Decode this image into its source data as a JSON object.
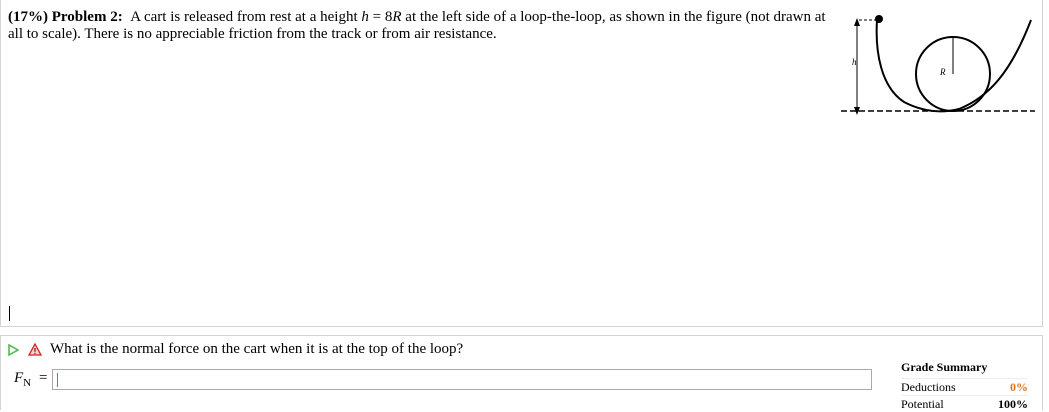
{
  "problem": {
    "percent": "(17%)",
    "label": "Problem 2:",
    "text_1": "A cart is released from rest at a height",
    "h_var": "h",
    "eq": " = 8",
    "r_var": "R",
    "text_2": " at the left side of a loop-the-loop, as shown in the figure (not drawn at all to scale). There is no appreciable friction from the track or from air resistance."
  },
  "figure": {
    "h_label": "h",
    "r_label": "R"
  },
  "question": {
    "text": "What is the normal force on the cart when it is at the top of the loop?",
    "input_label_main": "F",
    "input_label_sub": "N",
    "equals": "=",
    "input_value": ""
  },
  "grade_summary": {
    "title": "Grade Summary",
    "deductions_label": "Deductions",
    "deductions_value": "0%",
    "potential_label": "Potential",
    "potential_value": "100%"
  },
  "colors": {
    "play_icon": "#5cb85c",
    "warning_icon": "#cc2222",
    "deductions": "#e07020"
  }
}
